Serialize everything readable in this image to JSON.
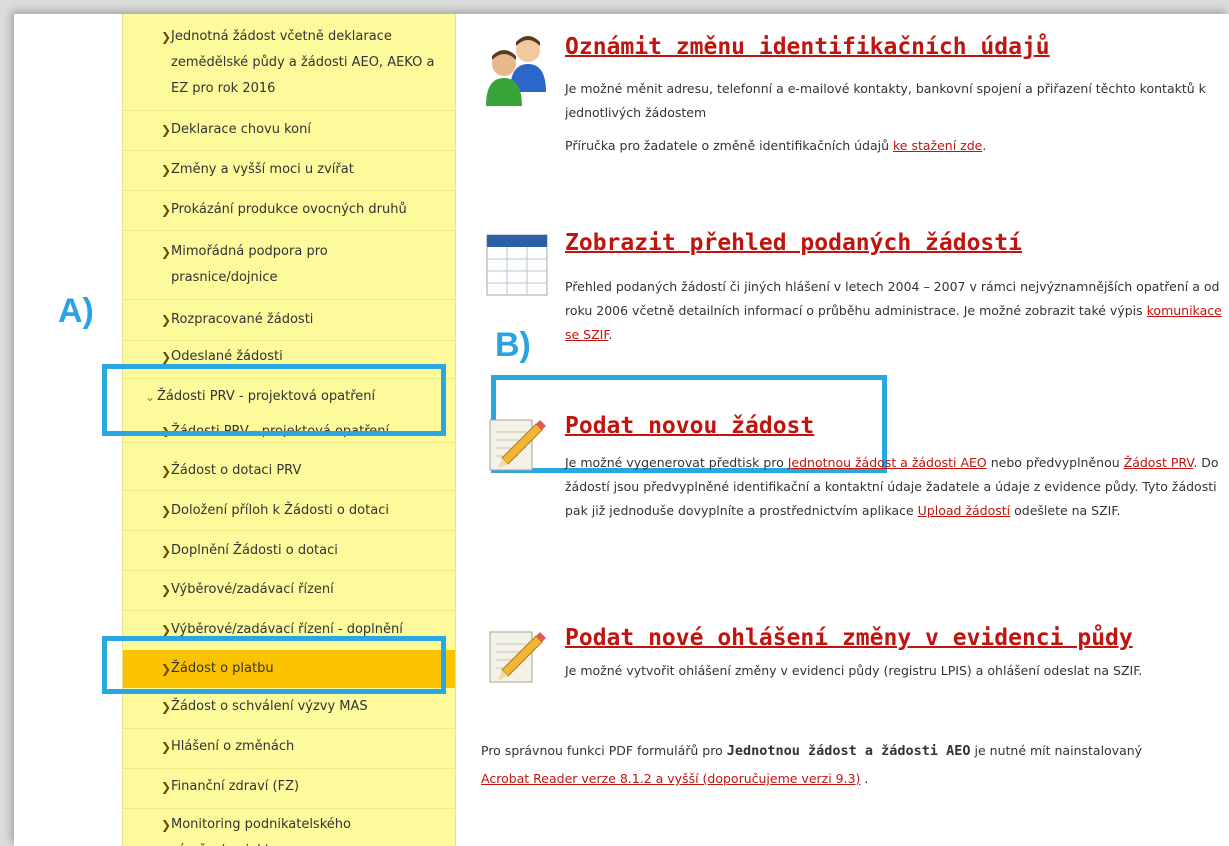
{
  "sidebar": {
    "items": [
      {
        "label": "Jednotná žádost včetně deklarace zemědělské půdy a žádosti AEO, AEKO a EZ pro rok 2016"
      },
      {
        "label": "Deklarace chovu koní"
      },
      {
        "label": "Změny a vyšší moci u zvířat"
      },
      {
        "label": "Prokázání produkce ovocných druhů"
      },
      {
        "label": "Mimořádná podpora pro prasnice/dojnice"
      },
      {
        "label": "Rozpracované žádosti"
      },
      {
        "label": "Odeslané žádosti"
      },
      {
        "label": "Žádosti PRV - projektová opatření"
      },
      {
        "label": "Žádosti PRV - projektová opatření"
      },
      {
        "label": "Žádost o dotaci PRV"
      },
      {
        "label": "Doložení příloh k Žádosti o dotaci"
      },
      {
        "label": "Doplnění Žádosti o dotaci"
      },
      {
        "label": "Výběrové/zadávací řízení"
      },
      {
        "label": "Výběrové/zadávací řízení - doplnění"
      },
      {
        "label": "Žádost o platbu"
      },
      {
        "label": "Žádost o schválení výzvy MAS"
      },
      {
        "label": "Hlášení o změnách"
      },
      {
        "label": "Finanční zdraví (FZ)"
      },
      {
        "label": "Monitoring podnikatelského záměru/projektu"
      }
    ]
  },
  "annotations": {
    "a": "A)",
    "b": "B)"
  },
  "sections": {
    "s1": {
      "title": "Oznámit změnu identifikačních údajů",
      "text1": "Je možné měnit adresu, telefonní a e-mailové kontakty, bankovní spojení a přiřazení těchto kontaktů k jednotlivých žádostem",
      "text2_pre": "Příručka pro žadatele o změně identifikačních údajů ",
      "text2_link": "ke stažení zde",
      "text2_post": "."
    },
    "s2": {
      "title": "Zobrazit přehled podaných žádostí",
      "text_pre": "Přehled podaných žádostí či jiných hlášení v letech 2004 – 2007 v rámci nejvýznamnějších opatření a od roku 2006 včetně detailních informací o průběhu administrace. Je možné zobrazit také výpis ",
      "text_link": "komunikace se SZIF",
      "text_post": "."
    },
    "s3": {
      "title": "Podat novou žádost",
      "t1": "Je možné vygenerovat předtisk pro ",
      "l1": "Jednotnou žádost a žádosti AEO",
      "t2": " nebo předvyplněnou ",
      "l2": "Žádost PRV",
      "t3": ". Do žádostí jsou předvyplněné identifikační a kontaktní údaje žadatele a údaje z evidence půdy. Tyto žádosti pak již jednoduše dovyplníte a prostřednictvím aplikace ",
      "l3": "Upload žádostí",
      "t4": " odešlete na SZIF."
    },
    "s4": {
      "title": "Podat nové ohlášení změny v evidenci půdy",
      "text": "Je možné vytvořit ohlášení změny v evidenci půdy (registru LPIS) a ohlášení odeslat na SZIF."
    }
  },
  "note": {
    "t1": "Pro správnou funkci PDF formulářů pro ",
    "b1": "Jednotnou žádost a žádosti AEO",
    "t2": " je nutné mít nainstalovaný ",
    "link": "Acrobat Reader verze 8.1.2 a vyšší (doporučujeme verzi 9.3)",
    "t3": " ."
  },
  "colors": {
    "accent": "#c0140e",
    "sidebar_bg": "#fdfa9c",
    "sidebar_active": "#fbc200",
    "annotation": "#29a8e0"
  },
  "icons": {
    "s1": "users-icon",
    "s2": "table-icon",
    "s3": "pencil-document-icon",
    "s4": "pencil-document-icon"
  }
}
